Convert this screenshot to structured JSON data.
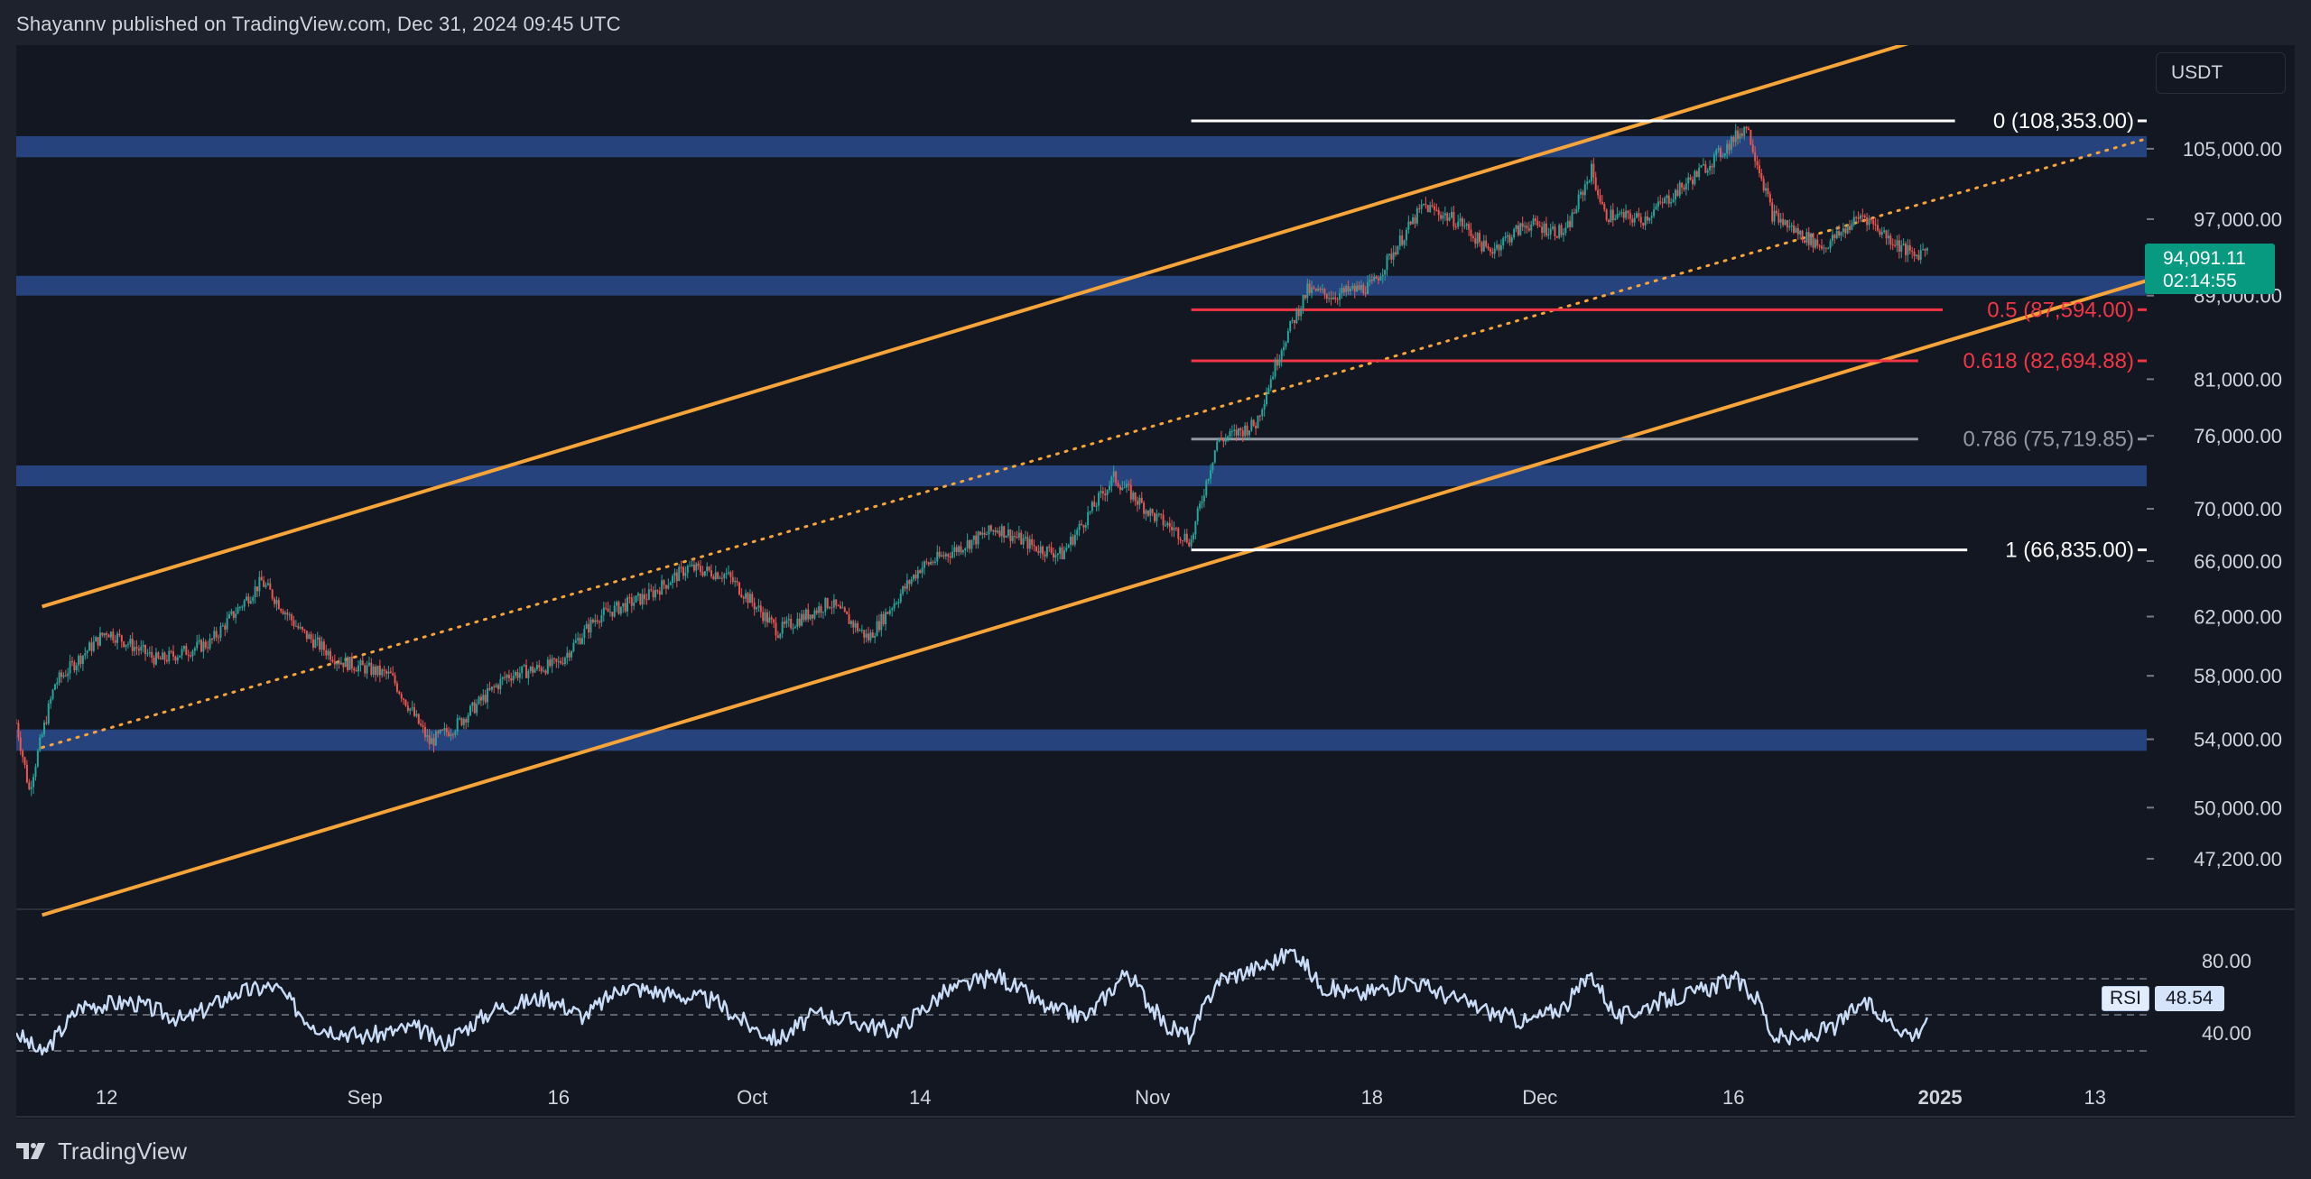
{
  "header": {
    "text": "Shayannv published on TradingView.com, Dec 31, 2024 09:45 UTC"
  },
  "footer": {
    "brand": "TradingView",
    "logo_icon": "tradingview-logo-icon"
  },
  "controls": {
    "currency": "USDT"
  },
  "price_tag": {
    "price": "94,091.11",
    "countdown": "02:14:55",
    "color": "#089981"
  },
  "rsi_badge": {
    "label": "RSI",
    "value": "48.54"
  },
  "colors": {
    "background": "#131722",
    "zone": "#2a4b8d",
    "channel": "#f7a53b",
    "fib_white": "#ffffff",
    "fib_red": "#f23645",
    "fib_grey": "#9598a1",
    "up": "#26a69a",
    "down": "#ef5350",
    "rsi_line": "#c9dcf7"
  },
  "chart_data": [
    {
      "type": "candlestick",
      "symbol_currency": "USDT",
      "y_scale": "log",
      "x_range": [
        "2024-08-05",
        "2025-01-17"
      ],
      "y_range": [
        44500,
        118000
      ],
      "x_ticks": [
        {
          "date": "2024-08-12",
          "label": "12"
        },
        {
          "date": "2024-09-01",
          "label": "Sep"
        },
        {
          "date": "2024-09-16",
          "label": "16"
        },
        {
          "date": "2024-10-01",
          "label": "Oct"
        },
        {
          "date": "2024-10-14",
          "label": "14"
        },
        {
          "date": "2024-11-01",
          "label": "Nov"
        },
        {
          "date": "2024-11-18",
          "label": "18"
        },
        {
          "date": "2024-12-01",
          "label": "Dec"
        },
        {
          "date": "2024-12-16",
          "label": "16"
        },
        {
          "date": "2025-01-01",
          "label": "2025"
        },
        {
          "date": "2025-01-13",
          "label": "13"
        }
      ],
      "y_ticks": [
        {
          "value": 105000,
          "label": "105,000.00"
        },
        {
          "value": 97000,
          "label": "97,000.00"
        },
        {
          "value": 89000,
          "label": "89,000.00"
        },
        {
          "value": 81000,
          "label": "81,000.00"
        },
        {
          "value": 76000,
          "label": "76,000.00"
        },
        {
          "value": 70000,
          "label": "70,000.00"
        },
        {
          "value": 66000,
          "label": "66,000.00"
        },
        {
          "value": 62000,
          "label": "62,000.00"
        },
        {
          "value": 58000,
          "label": "58,000.00"
        },
        {
          "value": 54000,
          "label": "54,000.00"
        },
        {
          "value": 50000,
          "label": "50,000.00"
        },
        {
          "value": 47200,
          "label": "47,200.00"
        }
      ],
      "price_path": [
        [
          "2024-08-05",
          55000
        ],
        [
          "2024-08-06",
          51000
        ],
        [
          "2024-08-08",
          57500
        ],
        [
          "2024-08-12",
          61000
        ],
        [
          "2024-08-16",
          59000
        ],
        [
          "2024-08-20",
          60200
        ],
        [
          "2024-08-24",
          64500
        ],
        [
          "2024-08-27",
          61000
        ],
        [
          "2024-08-30",
          59000
        ],
        [
          "2024-09-03",
          58000
        ],
        [
          "2024-09-06",
          53800
        ],
        [
          "2024-09-08",
          54800
        ],
        [
          "2024-09-12",
          58000
        ],
        [
          "2024-09-16",
          58800
        ],
        [
          "2024-09-19",
          62000
        ],
        [
          "2024-09-23",
          63500
        ],
        [
          "2024-09-26",
          65500
        ],
        [
          "2024-09-29",
          65000
        ],
        [
          "2024-10-03",
          61000
        ],
        [
          "2024-10-07",
          63000
        ],
        [
          "2024-10-10",
          60500
        ],
        [
          "2024-10-14",
          65500
        ],
        [
          "2024-10-20",
          68500
        ],
        [
          "2024-10-23",
          67000
        ],
        [
          "2024-10-25",
          66500
        ],
        [
          "2024-10-29",
          72500
        ],
        [
          "2024-11-01",
          69500
        ],
        [
          "2024-11-04",
          67500
        ],
        [
          "2024-11-06",
          75500
        ],
        [
          "2024-11-09",
          77000
        ],
        [
          "2024-11-11",
          84000
        ],
        [
          "2024-11-13",
          89500
        ],
        [
          "2024-11-15",
          89000
        ],
        [
          "2024-11-18",
          90000
        ],
        [
          "2024-11-22",
          98500
        ],
        [
          "2024-11-25",
          96500
        ],
        [
          "2024-11-27",
          93500
        ],
        [
          "2024-11-30",
          96500
        ],
        [
          "2024-12-03",
          95500
        ],
        [
          "2024-12-05",
          102500
        ],
        [
          "2024-12-06",
          97500
        ],
        [
          "2024-12-09",
          97000
        ],
        [
          "2024-12-12",
          100500
        ],
        [
          "2024-12-15",
          104500
        ],
        [
          "2024-12-17",
          107800
        ],
        [
          "2024-12-19",
          97500
        ],
        [
          "2024-12-21",
          95500
        ],
        [
          "2024-12-23",
          94000
        ],
        [
          "2024-12-26",
          97500
        ],
        [
          "2024-12-28",
          95000
        ],
        [
          "2024-12-30",
          93000
        ],
        [
          "2024-12-31",
          94091
        ]
      ],
      "support_resistance_zones": [
        {
          "low": 104000,
          "high": 106500
        },
        {
          "low": 89000,
          "high": 91000
        },
        {
          "low": 71800,
          "high": 73500
        },
        {
          "low": 53300,
          "high": 54600
        }
      ],
      "ascending_channel": {
        "upper": [
          [
            "2024-08-07",
            62700
          ],
          [
            "2024-12-31",
            119000
          ]
        ],
        "lower": [
          [
            "2024-08-07",
            44300
          ],
          [
            "2025-01-17",
            90500
          ]
        ],
        "mid_dotted": [
          [
            "2024-08-07",
            53500
          ],
          [
            "2025-01-17",
            106200
          ]
        ]
      },
      "fibonacci_retracement": {
        "start_date": "2024-11-04",
        "end_date": "2025-01-17",
        "levels": [
          {
            "ratio": "0",
            "price": "108,353.00",
            "value": 108353,
            "label": "0 (108,353.00)",
            "color": "#ffffff"
          },
          {
            "ratio": "0.5",
            "price": "87,594.00",
            "value": 87594,
            "label": "0.5 (87,594.00)",
            "color": "#f23645"
          },
          {
            "ratio": "0.618",
            "price": "82,694.88",
            "value": 82694.88,
            "label": "0.618 (82,694.88)",
            "color": "#f23645"
          },
          {
            "ratio": "0.786",
            "price": "75,719.85",
            "value": 75719.85,
            "label": "0.786 (75,719.85)",
            "color": "#9598a1"
          },
          {
            "ratio": "1",
            "price": "66,835.00",
            "value": 66835,
            "label": "1 (66,835.00)",
            "color": "#ffffff"
          }
        ]
      },
      "last_price": 94091.11
    },
    {
      "type": "line",
      "indicator": "RSI",
      "y_range": [
        20,
        95
      ],
      "y_ticks": [
        {
          "value": 80,
          "label": "80.00"
        },
        {
          "value": 40,
          "label": "40.00"
        }
      ],
      "bands": [
        70,
        50,
        30
      ],
      "series": [
        {
          "values": [
            [
              "2024-08-05",
              40
            ],
            [
              "2024-08-07",
              28
            ],
            [
              "2024-08-10",
              55
            ],
            [
              "2024-08-14",
              57
            ],
            [
              "2024-08-18",
              47
            ],
            [
              "2024-08-22",
              62
            ],
            [
              "2024-08-25",
              66
            ],
            [
              "2024-08-28",
              44
            ],
            [
              "2024-09-01",
              38
            ],
            [
              "2024-09-05",
              43
            ],
            [
              "2024-09-07",
              34
            ],
            [
              "2024-09-11",
              53
            ],
            [
              "2024-09-15",
              60
            ],
            [
              "2024-09-18",
              49
            ],
            [
              "2024-09-21",
              66
            ],
            [
              "2024-09-25",
              61
            ],
            [
              "2024-09-28",
              58
            ],
            [
              "2024-10-01",
              43
            ],
            [
              "2024-10-03",
              36
            ],
            [
              "2024-10-06",
              51
            ],
            [
              "2024-10-09",
              46
            ],
            [
              "2024-10-12",
              41
            ],
            [
              "2024-10-16",
              63
            ],
            [
              "2024-10-20",
              72
            ],
            [
              "2024-10-24",
              53
            ],
            [
              "2024-10-27",
              49
            ],
            [
              "2024-10-30",
              74
            ],
            [
              "2024-11-02",
              44
            ],
            [
              "2024-11-04",
              38
            ],
            [
              "2024-11-06",
              69
            ],
            [
              "2024-11-10",
              78
            ],
            [
              "2024-11-12",
              86
            ],
            [
              "2024-11-14",
              66
            ],
            [
              "2024-11-17",
              61
            ],
            [
              "2024-11-21",
              69
            ],
            [
              "2024-11-24",
              60
            ],
            [
              "2024-11-27",
              52
            ],
            [
              "2024-11-30",
              46
            ],
            [
              "2024-12-03",
              55
            ],
            [
              "2024-12-05",
              73
            ],
            [
              "2024-12-07",
              48
            ],
            [
              "2024-12-10",
              57
            ],
            [
              "2024-12-13",
              62
            ],
            [
              "2024-12-16",
              70
            ],
            [
              "2024-12-18",
              58
            ],
            [
              "2024-12-19",
              38
            ],
            [
              "2024-12-21",
              36
            ],
            [
              "2024-12-24",
              44
            ],
            [
              "2024-12-26",
              57
            ],
            [
              "2024-12-28",
              47
            ],
            [
              "2024-12-30",
              38
            ],
            [
              "2024-12-31",
              48.54
            ]
          ]
        }
      ],
      "last_value": 48.54
    }
  ]
}
